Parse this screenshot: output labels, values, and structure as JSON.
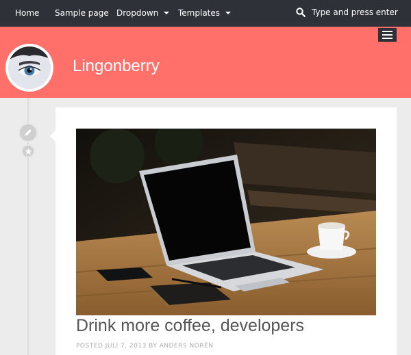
{
  "nav": {
    "items": [
      {
        "label": "Home"
      },
      {
        "label": "Sample page"
      },
      {
        "label": "Dropdown"
      },
      {
        "label": "Templates"
      }
    ],
    "search_placeholder": "Type and press enter"
  },
  "header": {
    "site_title": "Lingonberry"
  },
  "post": {
    "title": "Drink more coffee, developers",
    "meta": "POSTED JULI 7, 2013 BY ANDERS NORÉN"
  },
  "colors": {
    "nav_bg": "#2e3238",
    "header_bg": "#ff706a",
    "page_bg": "#ececec"
  }
}
